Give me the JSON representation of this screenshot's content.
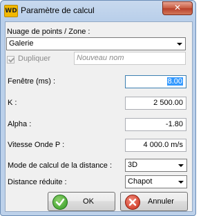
{
  "window": {
    "title": "Paramètre de calcul",
    "app_icon": "WD",
    "close_glyph": "✕"
  },
  "nuage": {
    "label": "Nuage de points / Zone :",
    "value": "Galerie"
  },
  "dupliquer": {
    "label": "Dupliquer",
    "checked": true,
    "enabled": false,
    "placeholder": "Nouveau nom"
  },
  "fenetre": {
    "label": "Fenêtre (ms) :",
    "value": "8.00"
  },
  "k": {
    "label": "K :",
    "value": "2 500.00"
  },
  "alpha": {
    "label": "Alpha :",
    "value": "-1.80"
  },
  "vitesse": {
    "label": "Vitesse Onde P :",
    "value": "4 000.0 m/s"
  },
  "mode": {
    "label": "Mode de calcul de la distance :",
    "value": "3D"
  },
  "distance": {
    "label": "Distance réduite :",
    "value": "Chapot"
  },
  "buttons": {
    "ok": "OK",
    "cancel": "Annuler"
  },
  "icons": {
    "ok": "check-circle-icon",
    "cancel": "x-circle-icon",
    "dropdown": "chevron-down-icon"
  }
}
